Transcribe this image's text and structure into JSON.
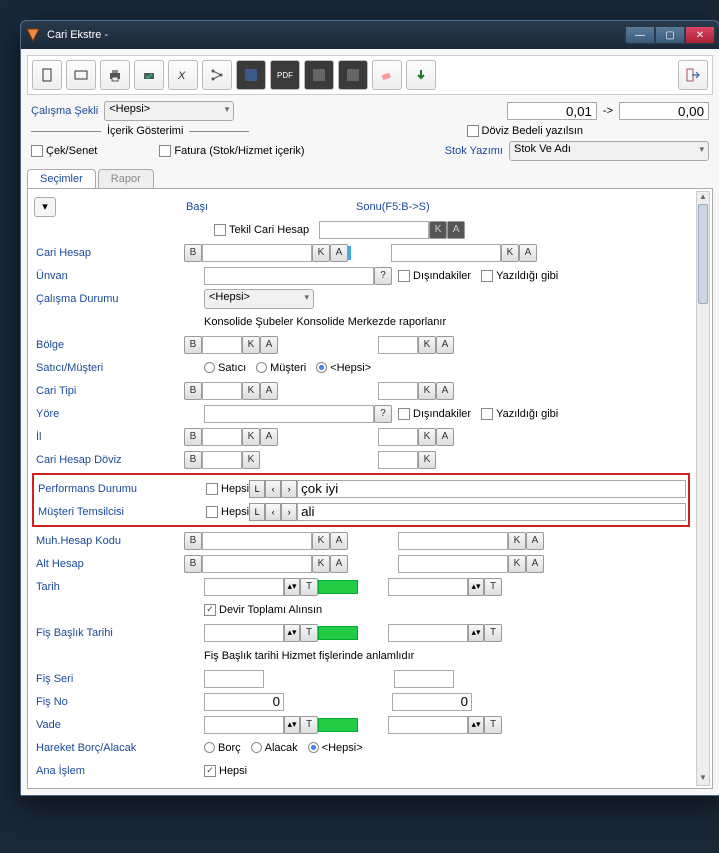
{
  "title": "Cari Ekstre -",
  "toolbar": {
    "export_pdf": "PDF"
  },
  "top": {
    "calisma_sekli_label": "Çalışma Şekli",
    "calisma_sekli_value": "<Hepsi>",
    "num1": "0,01",
    "arrow": "->",
    "num2": "0,00",
    "icerik_gosterimi": "İçerik Gösterimi",
    "doviz_bedeli": "Döviz Bedeli yazılsın",
    "cek_senet": "Çek/Senet",
    "fatura": "Fatura (Stok/Hizmet içerik)",
    "stok_yazimi_label": "Stok Yazımı",
    "stok_yazimi_value": "Stok Ve Adı"
  },
  "tabs": {
    "secimler": "Seçimler",
    "rapor": "Rapor"
  },
  "headers": {
    "basi": "Başı",
    "sonu": "Sonu(F5:B->S)",
    "tekil": "Tekil Cari Hesap"
  },
  "labels": {
    "cari_hesap": "Cari Hesap",
    "unvan": "Ünvan",
    "calisma_durumu": "Çalışma Durumu",
    "konsolide": "Konsolide Şubeler Konsolide Merkezde raporlanır",
    "bolge": "Bölge",
    "satici_musteri": "Satıcı/Müşteri",
    "cari_tipi": "Cari Tipi",
    "yore": "Yöre",
    "il": "İl",
    "cari_hesap_doviz": "Cari Hesap Döviz",
    "performans_durumu": "Performans Durumu",
    "musteri_temsilcisi": "Müşteri Temsilcisi",
    "muh_hesap_kodu": "Muh.Hesap Kodu",
    "alt_hesap": "Alt Hesap",
    "tarih": "Tarih",
    "devir": "Devir Toplamı Alınsın",
    "fis_baslik_tarihi": "Fiş Başlık Tarihi",
    "fis_baslik_note": "Fiş Başlık tarihi Hizmet fişlerinde anlamlıdır",
    "fis_seri": "Fiş Seri",
    "fis_no": "Fiş No",
    "vade": "Vade",
    "hareket_borc_alacak": "Hareket Borç/Alacak",
    "ana_islem": "Ana İşlem",
    "disindakiler": "Dışındakiler",
    "yazildigi_gibi": "Yazıldığı gibi",
    "hepsi_chk": "Hepsi"
  },
  "buttons": {
    "B": "B",
    "K": "K",
    "A": "A",
    "L": "L",
    "Q": "?",
    "T": "T",
    "left": "‹",
    "right": "›"
  },
  "values": {
    "hepsi_dropdown": "<Hepsi>",
    "performans_val": "çok iyi",
    "temsilci_val": "ali",
    "fisno_start": "0",
    "fisno_end": "0"
  },
  "radios": {
    "satici": "Satıcı",
    "musteri": "Müşteri",
    "hepsi": "<Hepsi>",
    "borc": "Borç",
    "alacak": "Alacak"
  }
}
